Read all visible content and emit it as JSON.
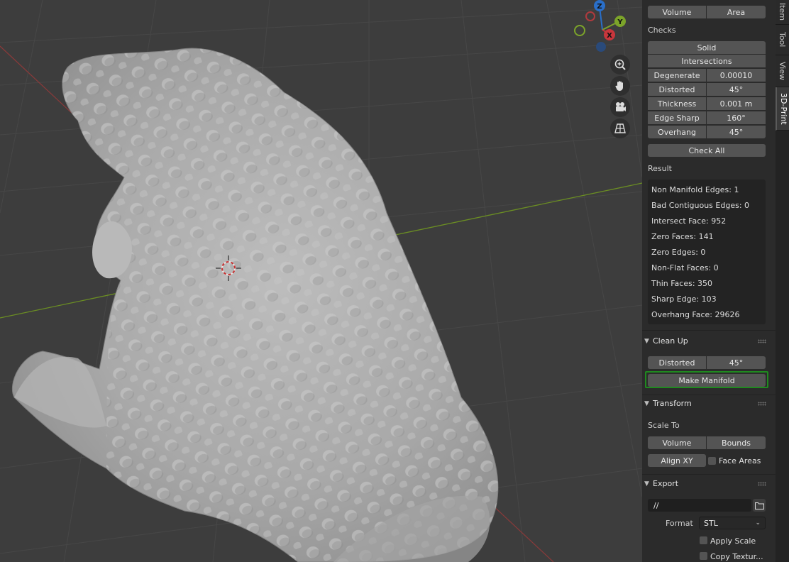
{
  "gizmo": {
    "z": "Z",
    "y": "Y",
    "x": "X"
  },
  "sidebar": {
    "top_buttons": [
      "Volume",
      "Area"
    ],
    "checks_label": "Checks",
    "solid": "Solid",
    "intersections": "Intersections",
    "check_rows": [
      {
        "label": "Degenerate",
        "value": "0.00010"
      },
      {
        "label": "Distorted",
        "value": "45°"
      },
      {
        "label": "Thickness",
        "value": "0.001 m"
      },
      {
        "label": "Edge Sharp",
        "value": "160°"
      },
      {
        "label": "Overhang",
        "value": "45°"
      }
    ],
    "check_all": "Check All",
    "result_label": "Result",
    "results": [
      "Non Manifold Edges: 1",
      "Bad Contiguous Edges: 0",
      "Intersect Face: 952",
      "Zero Faces: 141",
      "Zero Edges: 0",
      "Non-Flat Faces: 0",
      "Thin Faces: 350",
      "Sharp Edge: 103",
      "Overhang Face: 29626"
    ],
    "cleanup": {
      "title": "Clean Up",
      "distorted_label": "Distorted",
      "distorted_value": "45°",
      "make_manifold": "Make Manifold"
    },
    "transform": {
      "title": "Transform",
      "scale_to": "Scale To",
      "volume": "Volume",
      "bounds": "Bounds",
      "align_xy": "Align XY",
      "face_areas": "Face Areas"
    },
    "export": {
      "title": "Export",
      "path": "//",
      "format_label": "Format",
      "format_value": "STL",
      "apply_scale": "Apply Scale",
      "copy_textures": "Copy Textur..."
    }
  },
  "tabs": [
    "Item",
    "Tool",
    "View",
    "3D-Print"
  ],
  "colors": {
    "accent_highlight": "#1f8a1f",
    "panel": "#2b2b2b",
    "viewport": "#3d3d3d"
  }
}
